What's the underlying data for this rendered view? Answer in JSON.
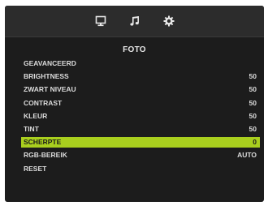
{
  "tabs": [
    {
      "icon": "monitor-icon",
      "active": true
    },
    {
      "icon": "music-note-icon",
      "active": false
    },
    {
      "icon": "gear-icon",
      "active": false
    }
  ],
  "section_title": "FOTO",
  "menu": [
    {
      "label": "GEAVANCEERD",
      "value": ""
    },
    {
      "label": "BRIGHTNESS",
      "value": "50"
    },
    {
      "label": "ZWART NIVEAU",
      "value": "50"
    },
    {
      "label": "CONTRAST",
      "value": "50"
    },
    {
      "label": "KLEUR",
      "value": "50"
    },
    {
      "label": "TINT",
      "value": "50"
    },
    {
      "label": "SCHERPTE",
      "value": "0"
    },
    {
      "label": "RGB-BEREIK",
      "value": "AUTO"
    },
    {
      "label": "RESET",
      "value": ""
    }
  ],
  "selected_index": 6,
  "colors": {
    "background": "#1c1c1c",
    "tabbar": "#2c2c2c",
    "highlight": "#a9cf1e",
    "text": "#dcdcdc"
  }
}
